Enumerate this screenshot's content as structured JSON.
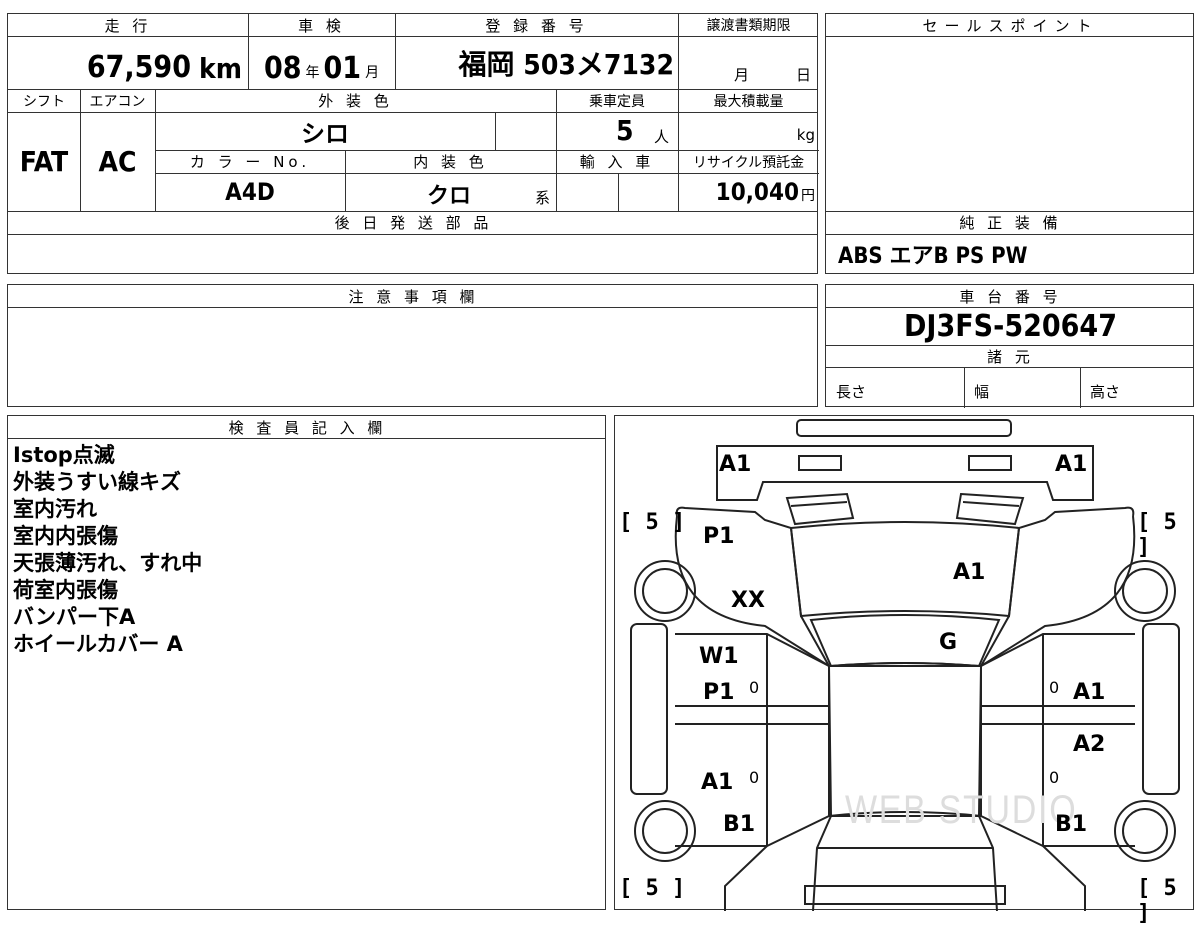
{
  "top": {
    "mileage_label": "走 行",
    "mileage_value": "67,590",
    "mileage_unit": "km",
    "inspection_label": "車 検",
    "inspection_year": "08",
    "inspection_year_unit": "年",
    "inspection_month": "01",
    "inspection_month_unit": "月",
    "registration_label": "登 録 番 号",
    "registration_value": "福岡 503メ7132",
    "transfer_label": "譲渡書類期限",
    "transfer_month_unit": "月",
    "transfer_day_unit": "日",
    "shift_label": "シフト",
    "shift_value": "FAT",
    "ac_label": "エアコン",
    "ac_value": "AC",
    "exterior_label": "外 装 色",
    "exterior_value": "シロ",
    "capacity_label": "乗車定員",
    "capacity_value": "5",
    "capacity_unit": "人",
    "maxload_label": "最大積載量",
    "maxload_unit": "kg",
    "color_no_label": "カ ラ ー No.",
    "color_no_value": "A4D",
    "interior_label": "内 装 色",
    "interior_value": "クロ",
    "interior_suffix": "系",
    "import_label": "輸 入 車",
    "recycle_label": "リサイクル預託金",
    "recycle_value": "10,040",
    "recycle_unit": "円",
    "later_parts_label": "後 日 発 送 部 品"
  },
  "sales_point": {
    "label": "セールスポイント"
  },
  "standard_equipment": {
    "label": "純 正 装 備",
    "value": "ABS エアB PS PW"
  },
  "notes": {
    "label": "注 意 事 項 欄"
  },
  "chassis": {
    "label": "車 台 番 号",
    "value": "DJ3FS-520647"
  },
  "specs": {
    "label": "諸 元",
    "length": "長さ",
    "width": "幅",
    "height": "高さ"
  },
  "inspector": {
    "label": "検 査 員 記 入 欄",
    "lines": [
      "Istop点滅",
      "外装うすい線キズ",
      "室内汚れ",
      "室内内張傷",
      "天張薄汚れ、すれ中",
      "荷室内張傷",
      "バンパー下A",
      "ホイールカバー A"
    ]
  },
  "diagram": {
    "labels": {
      "front_left": "A1",
      "front_right": "A1",
      "fender_left": "P1",
      "hood": "A1",
      "left_xx": "XX",
      "windshield": "G",
      "door_fl_top": "W1",
      "door_fl": "P1",
      "door_fr": "A1",
      "door_rr": "A2",
      "door_rl": "A1",
      "rear_left": "B1",
      "rear_right": "B1",
      "zero_1": "0",
      "zero_2": "0",
      "zero_3": "0",
      "zero_4": "0"
    },
    "tires": {
      "fl": "5",
      "fr": "5",
      "rl": "5",
      "rr": "5"
    },
    "watermark": "WEB STUDIO"
  }
}
